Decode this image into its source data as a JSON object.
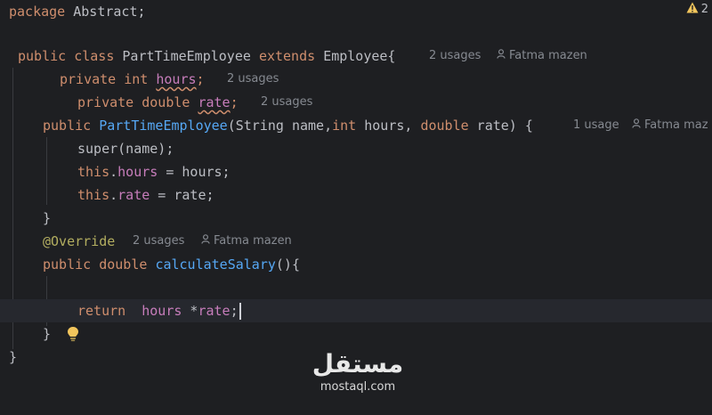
{
  "editor": {
    "lines": {
      "l1": {
        "pkg": "package",
        "name": "Abstract;"
      },
      "l3": {
        "public": "public",
        "class": "class",
        "name": "PartTimeEmployee",
        "extends": "extends",
        "parent": "Employee{",
        "usages": "2 usages",
        "author": "Fatma mazen"
      },
      "l4": {
        "private": "private",
        "type": "int",
        "field": "hours",
        "semi": ";",
        "usages": "2 usages"
      },
      "l5": {
        "private": "private",
        "type": "double",
        "field": "rate",
        "semi": ";",
        "usages": "2 usages"
      },
      "l6": {
        "public": "public",
        "ctor": "PartTimeEmployee",
        "params1": "(String name,",
        "int": "int",
        "params2": " hours, ",
        "double": "double",
        "params3": " rate) {",
        "usages": "1 usage",
        "author": "Fatma maz"
      },
      "l7": {
        "call": "super(name);"
      },
      "l8": {
        "this": "this",
        "dot": ".",
        "field": "hours",
        "rest": " = hours;"
      },
      "l9": {
        "this": "this",
        "dot": ".",
        "field": "rate",
        "rest": " = rate;"
      },
      "l10": {
        "brace": "}"
      },
      "l11": {
        "annotation": "@Override",
        "usages": "2 usages",
        "author": "Fatma mazen"
      },
      "l12": {
        "public": "public",
        "double": "double",
        "method": "calculateSalary",
        "rest": "(){"
      },
      "l14": {
        "return": "return",
        "f1": "hours",
        "op": " *",
        "f2": "rate",
        "semi": ";"
      },
      "l15": {
        "brace": "}"
      },
      "l16": {
        "brace": "}"
      }
    }
  },
  "warnings": {
    "count": "2"
  },
  "watermark": {
    "arabic": "مستقل",
    "latin": "mostaql.com"
  }
}
